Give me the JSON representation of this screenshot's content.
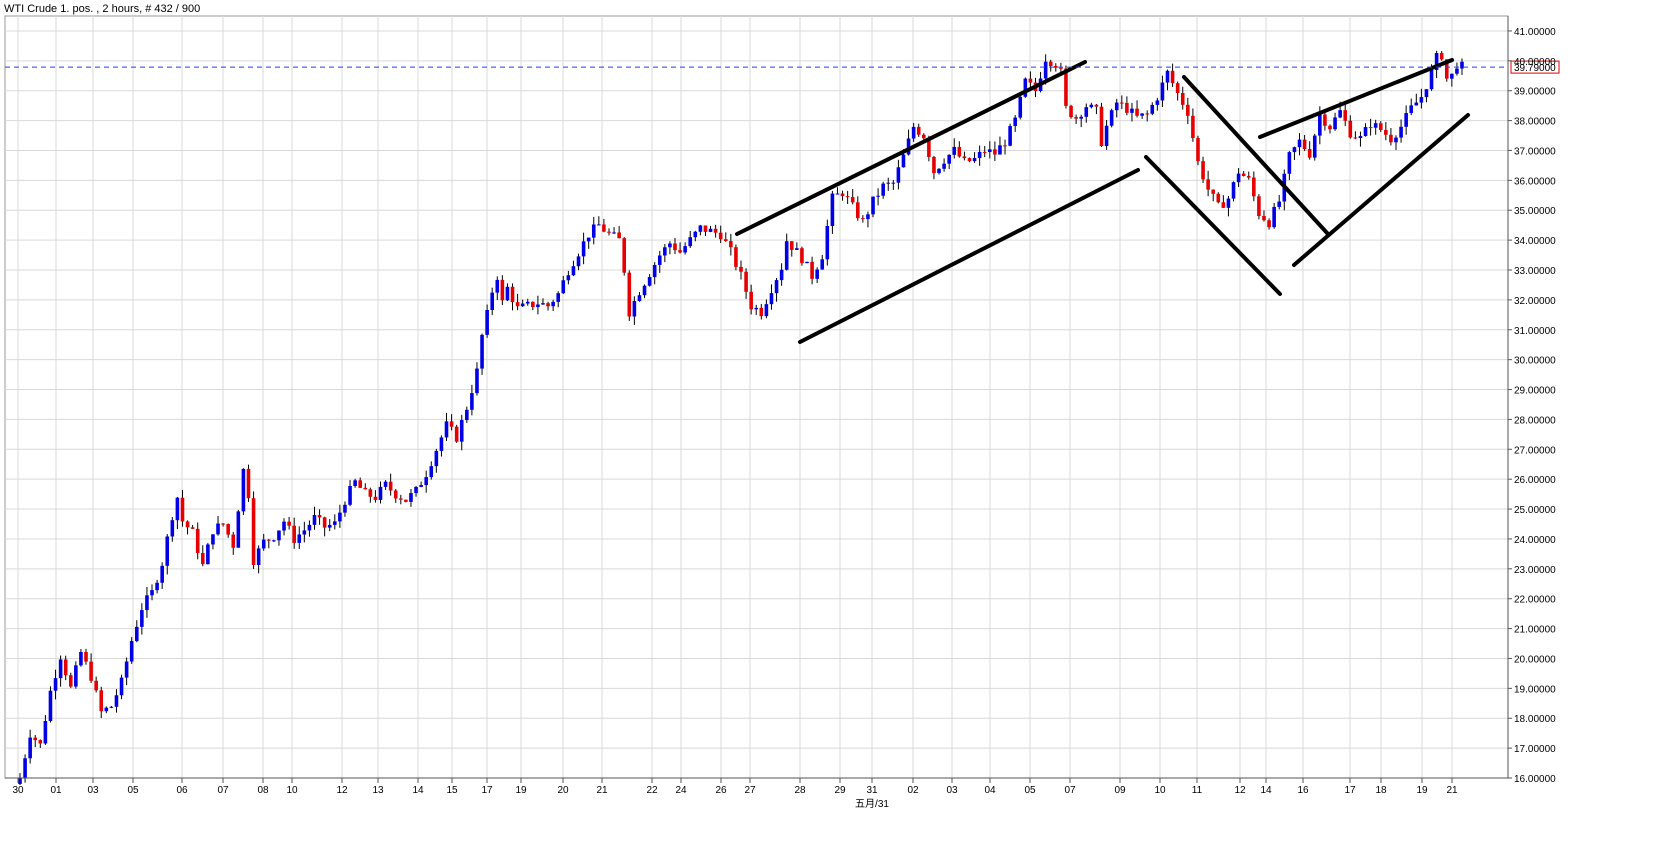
{
  "header": {
    "title": "WTI Crude 1. pos. , 2 hours, # 432 / 900"
  },
  "colors": {
    "up": "#0000e6",
    "down": "#e60000",
    "wick": "#000000",
    "price_line": "#1f3fff",
    "grid": "#d9d9d9"
  },
  "chart_data": {
    "type": "candlestick",
    "title": "WTI Crude 1. pos. , 2 hours, # 432 / 900",
    "ylim": [
      16,
      41.5
    ],
    "y_ticks": [
      "16.00000",
      "17.00000",
      "18.00000",
      "19.00000",
      "20.00000",
      "21.00000",
      "22.00000",
      "23.00000",
      "24.00000",
      "25.00000",
      "26.00000",
      "27.00000",
      "28.00000",
      "29.00000",
      "30.00000",
      "31.00000",
      "32.00000",
      "33.00000",
      "34.00000",
      "35.00000",
      "36.00000",
      "37.00000",
      "38.00000",
      "39.00000",
      "40.00000",
      "41.00000"
    ],
    "x_ticks": [
      "30",
      "01",
      "03",
      "05",
      "06",
      "07",
      "08",
      "10",
      "12",
      "13",
      "14",
      "15",
      "17",
      "19",
      "20",
      "21",
      "22",
      "24",
      "26",
      "27",
      "28",
      "29",
      "31",
      "02",
      "03",
      "04",
      "05",
      "07",
      "09",
      "10",
      "11",
      "12",
      "14",
      "16",
      "17",
      "18",
      "19",
      "21"
    ],
    "x_sub_label": "五月/31",
    "current_price": "39.79000",
    "price_anchors": [
      [
        0,
        16.0
      ],
      [
        2,
        17.5
      ],
      [
        4,
        17.1
      ],
      [
        6,
        18.9
      ],
      [
        8,
        20.1
      ],
      [
        10,
        19.0
      ],
      [
        12,
        20.2
      ],
      [
        14,
        19.4
      ],
      [
        16,
        18.2
      ],
      [
        18,
        18.4
      ],
      [
        20,
        19.2
      ],
      [
        22,
        20.6
      ],
      [
        24,
        21.7
      ],
      [
        26,
        22.2
      ],
      [
        28,
        23.2
      ],
      [
        30,
        24.8
      ],
      [
        31,
        25.4
      ],
      [
        32,
        24.6
      ],
      [
        34,
        24.2
      ],
      [
        36,
        23.1
      ],
      [
        38,
        24.3
      ],
      [
        40,
        24.5
      ],
      [
        42,
        23.8
      ],
      [
        44,
        26.3
      ],
      [
        45,
        25.5
      ],
      [
        46,
        23.3
      ],
      [
        48,
        23.9
      ],
      [
        50,
        24.1
      ],
      [
        52,
        24.6
      ],
      [
        54,
        24.0
      ],
      [
        56,
        24.3
      ],
      [
        58,
        24.7
      ],
      [
        60,
        24.4
      ],
      [
        62,
        24.5
      ],
      [
        64,
        25.3
      ],
      [
        66,
        25.9
      ],
      [
        68,
        25.5
      ],
      [
        70,
        25.4
      ],
      [
        72,
        25.8
      ],
      [
        74,
        25.5
      ],
      [
        76,
        25.3
      ],
      [
        78,
        25.6
      ],
      [
        80,
        26.2
      ],
      [
        82,
        27.0
      ],
      [
        84,
        27.8
      ],
      [
        86,
        27.4
      ],
      [
        88,
        28.4
      ],
      [
        90,
        29.6
      ],
      [
        91,
        30.8
      ],
      [
        92,
        31.5
      ],
      [
        93,
        32.3
      ],
      [
        94,
        32.8
      ],
      [
        95,
        31.9
      ],
      [
        96,
        32.4
      ],
      [
        98,
        31.7
      ],
      [
        100,
        31.8
      ],
      [
        102,
        31.9
      ],
      [
        104,
        31.8
      ],
      [
        106,
        32.2
      ],
      [
        108,
        33.0
      ],
      [
        110,
        33.6
      ],
      [
        112,
        34.2
      ],
      [
        114,
        34.5
      ],
      [
        116,
        34.2
      ],
      [
        118,
        34.0
      ],
      [
        119,
        33.0
      ],
      [
        120,
        31.6
      ],
      [
        122,
        32.3
      ],
      [
        124,
        32.9
      ],
      [
        126,
        33.5
      ],
      [
        128,
        33.9
      ],
      [
        130,
        33.6
      ],
      [
        132,
        34.0
      ],
      [
        134,
        34.4
      ],
      [
        136,
        34.3
      ],
      [
        138,
        34.2
      ],
      [
        140,
        33.6
      ],
      [
        142,
        32.8
      ],
      [
        144,
        31.8
      ],
      [
        146,
        31.6
      ],
      [
        148,
        32.4
      ],
      [
        150,
        33.1
      ],
      [
        151,
        34.0
      ],
      [
        152,
        33.8
      ],
      [
        154,
        33.4
      ],
      [
        156,
        32.8
      ],
      [
        158,
        33.5
      ],
      [
        160,
        35.4
      ],
      [
        162,
        35.6
      ],
      [
        164,
        35.1
      ],
      [
        166,
        34.6
      ],
      [
        168,
        35.3
      ],
      [
        170,
        35.8
      ],
      [
        172,
        35.9
      ],
      [
        174,
        36.8
      ],
      [
        176,
        37.8
      ],
      [
        178,
        37.5
      ],
      [
        180,
        36.3
      ],
      [
        182,
        36.7
      ],
      [
        184,
        37.0
      ],
      [
        186,
        36.6
      ],
      [
        188,
        36.7
      ],
      [
        190,
        37.0
      ],
      [
        192,
        36.9
      ],
      [
        194,
        37.3
      ],
      [
        196,
        38.0
      ],
      [
        198,
        39.3
      ],
      [
        200,
        39.0
      ],
      [
        202,
        40.1
      ],
      [
        204,
        39.9
      ],
      [
        205,
        39.6
      ],
      [
        206,
        38.4
      ],
      [
        208,
        38.1
      ],
      [
        210,
        38.5
      ],
      [
        212,
        38.3
      ],
      [
        213,
        37.3
      ],
      [
        214,
        37.8
      ],
      [
        216,
        38.6
      ],
      [
        218,
        38.4
      ],
      [
        220,
        38.1
      ],
      [
        222,
        38.2
      ],
      [
        224,
        38.8
      ],
      [
        226,
        39.6
      ],
      [
        228,
        38.9
      ],
      [
        230,
        38.3
      ],
      [
        232,
        36.6
      ],
      [
        234,
        35.7
      ],
      [
        236,
        35.1
      ],
      [
        238,
        35.4
      ],
      [
        240,
        36.3
      ],
      [
        242,
        36.0
      ],
      [
        244,
        34.9
      ],
      [
        246,
        34.6
      ],
      [
        248,
        35.3
      ],
      [
        250,
        36.8
      ],
      [
        252,
        37.3
      ],
      [
        254,
        36.9
      ],
      [
        256,
        38.2
      ],
      [
        258,
        37.8
      ],
      [
        260,
        38.3
      ],
      [
        262,
        37.6
      ],
      [
        264,
        37.4
      ],
      [
        266,
        37.9
      ],
      [
        268,
        37.7
      ],
      [
        270,
        37.4
      ],
      [
        272,
        37.8
      ],
      [
        274,
        38.4
      ],
      [
        276,
        38.8
      ],
      [
        277,
        39.2
      ],
      [
        278,
        39.6
      ],
      [
        279,
        40.1
      ],
      [
        280,
        40.2
      ],
      [
        281,
        39.4
      ],
      [
        282,
        39.5
      ],
      [
        283,
        39.9
      ],
      [
        284,
        39.8
      ]
    ]
  }
}
